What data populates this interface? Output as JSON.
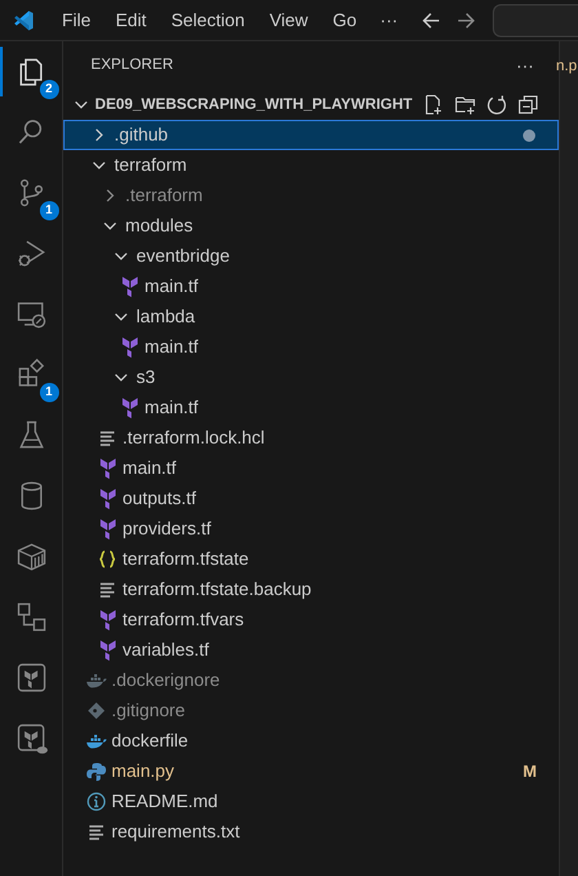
{
  "menu": [
    {
      "label": "File"
    },
    {
      "label": "Edit"
    },
    {
      "label": "Selection"
    },
    {
      "label": "View"
    },
    {
      "label": "Go"
    }
  ],
  "menu_more": "···",
  "activity_bar": [
    {
      "kind": "files",
      "selected": true,
      "badge": "2"
    },
    {
      "kind": "search",
      "selected": false
    },
    {
      "kind": "source-control",
      "selected": false,
      "badge": "1"
    },
    {
      "kind": "debug",
      "selected": false
    },
    {
      "kind": "remote",
      "selected": false
    },
    {
      "kind": "extensions",
      "selected": false,
      "badge": "1"
    },
    {
      "kind": "flask",
      "selected": false
    },
    {
      "kind": "database",
      "selected": false
    },
    {
      "kind": "container",
      "selected": false
    },
    {
      "kind": "diagram",
      "selected": false
    },
    {
      "kind": "terraform",
      "selected": false
    },
    {
      "kind": "terraform-cloud",
      "selected": false
    }
  ],
  "explorer": {
    "title": "EXPLORER",
    "more": "···",
    "root": "DE09_WEBSCRAPING_WITH_PLAYWRIGHT",
    "tree": [
      {
        "label": ".github",
        "kind": "folder",
        "expanded": false,
        "selected": true,
        "dimmed": false,
        "has_changes": true
      },
      {
        "label": "terraform",
        "kind": "folder",
        "expanded": true,
        "selected": false,
        "dimmed": false,
        "children": [
          {
            "label": ".terraform",
            "kind": "folder",
            "expanded": false,
            "selected": false,
            "dimmed": true
          },
          {
            "label": "modules",
            "kind": "folder",
            "expanded": true,
            "selected": false,
            "dimmed": false,
            "children": [
              {
                "label": "eventbridge",
                "kind": "folder",
                "expanded": true,
                "selected": false,
                "dimmed": false,
                "children": [
                  {
                    "label": "main.tf",
                    "kind": "terraform",
                    "selected": false,
                    "dimmed": false
                  }
                ]
              },
              {
                "label": "lambda",
                "kind": "folder",
                "expanded": true,
                "selected": false,
                "dimmed": false,
                "children": [
                  {
                    "label": "main.tf",
                    "kind": "terraform",
                    "selected": false,
                    "dimmed": false
                  }
                ]
              },
              {
                "label": "s3",
                "kind": "folder",
                "expanded": true,
                "selected": false,
                "dimmed": false,
                "children": [
                  {
                    "label": "main.tf",
                    "kind": "terraform",
                    "selected": false,
                    "dimmed": false
                  }
                ]
              }
            ]
          },
          {
            "label": ".terraform.lock.hcl",
            "kind": "text",
            "selected": false,
            "dimmed": false
          },
          {
            "label": "main.tf",
            "kind": "terraform",
            "selected": false,
            "dimmed": false
          },
          {
            "label": "outputs.tf",
            "kind": "terraform",
            "selected": false,
            "dimmed": false
          },
          {
            "label": "providers.tf",
            "kind": "terraform",
            "selected": false,
            "dimmed": false
          },
          {
            "label": "terraform.tfstate",
            "kind": "json",
            "selected": false,
            "dimmed": false
          },
          {
            "label": "terraform.tfstate.backup",
            "kind": "text",
            "selected": false,
            "dimmed": false
          },
          {
            "label": "terraform.tfvars",
            "kind": "terraform",
            "selected": false,
            "dimmed": false
          },
          {
            "label": "variables.tf",
            "kind": "terraform",
            "selected": false,
            "dimmed": false
          }
        ]
      },
      {
        "label": ".dockerignore",
        "kind": "docker",
        "selected": false,
        "dimmed": true
      },
      {
        "label": ".gitignore",
        "kind": "git",
        "selected": false,
        "dimmed": true
      },
      {
        "label": "dockerfile",
        "kind": "docker",
        "selected": false,
        "dimmed": false
      },
      {
        "label": "main.py",
        "kind": "python",
        "selected": false,
        "dimmed": false,
        "status": "M"
      },
      {
        "label": "README.md",
        "kind": "info",
        "selected": false,
        "dimmed": false
      },
      {
        "label": "requirements.txt",
        "kind": "text",
        "selected": false,
        "dimmed": false
      }
    ]
  },
  "editor_tab_fragment": "n.p"
}
